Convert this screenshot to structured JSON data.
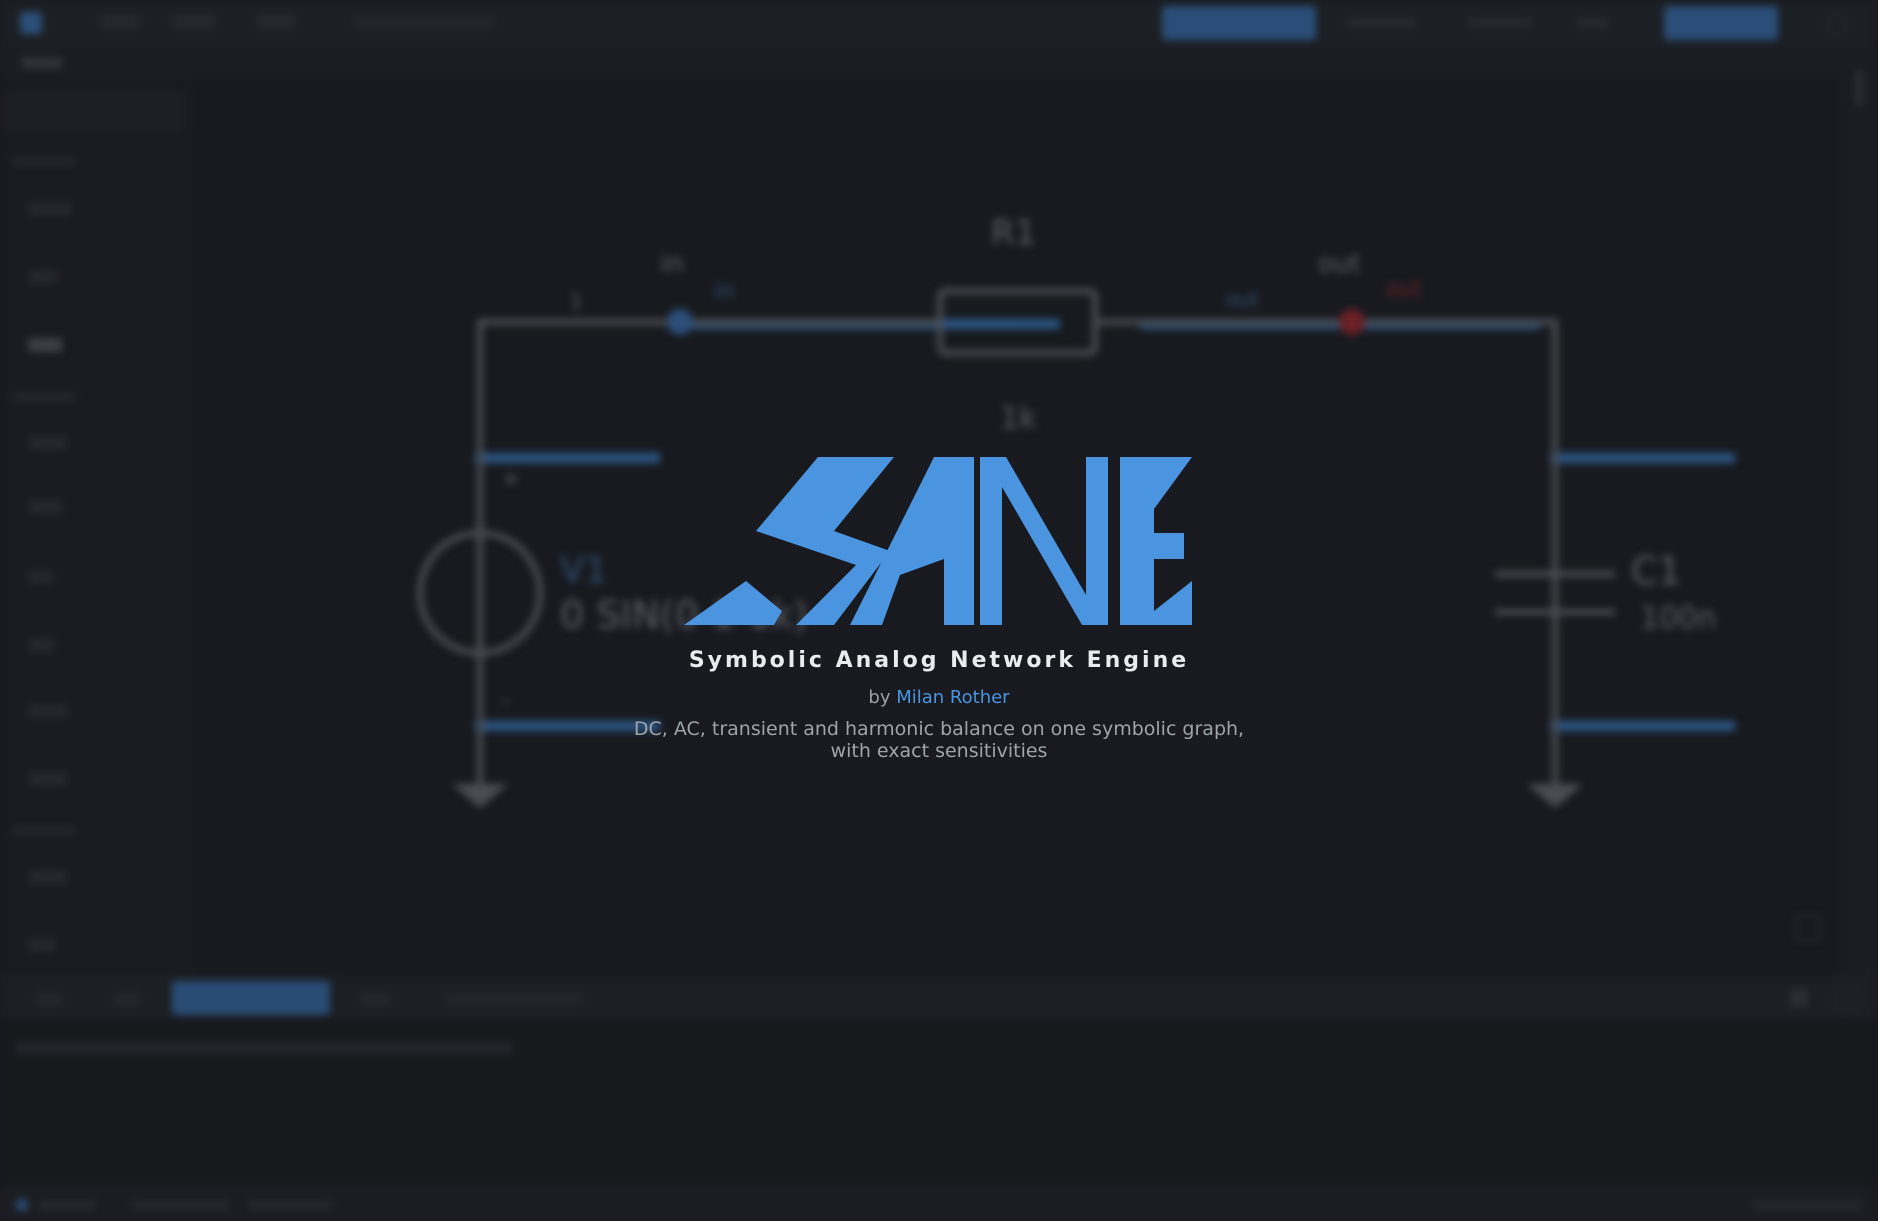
{
  "colors": {
    "accent": "#4a94e0",
    "background": "#181a1f",
    "wire": "#4a4d52",
    "net_highlight": "#2d5c8f",
    "probe_red": "#6a2025",
    "title_text": "#e9ebee",
    "muted_text": "#9ea4ac"
  },
  "splash": {
    "logo_text": "SANE",
    "title": "Symbolic Analog Network Engine",
    "author_prefix": "by",
    "author_name": "Milan Rother",
    "description_line1": "DC, AC, transient and harmonic balance on one symbolic graph,",
    "description_line2": "with exact sensitivities"
  },
  "schematic": {
    "resistor": {
      "name": "R1",
      "value": "1k"
    },
    "capacitor": {
      "name": "C1",
      "value": "100n"
    },
    "source": {
      "name": "V1",
      "value": "0 SIN(0 1 1k)"
    },
    "probe_in": {
      "label": "in",
      "tag": "in"
    },
    "probe_out": {
      "label": "out",
      "tag": "out"
    },
    "net_mid_label": "out",
    "pin_plus": "+",
    "pin_minus": "-",
    "pin_one": "1"
  },
  "icons": {
    "app": "app-logo-icon",
    "settings": "gear-icon",
    "zoom": "zoom-fit-icon"
  }
}
